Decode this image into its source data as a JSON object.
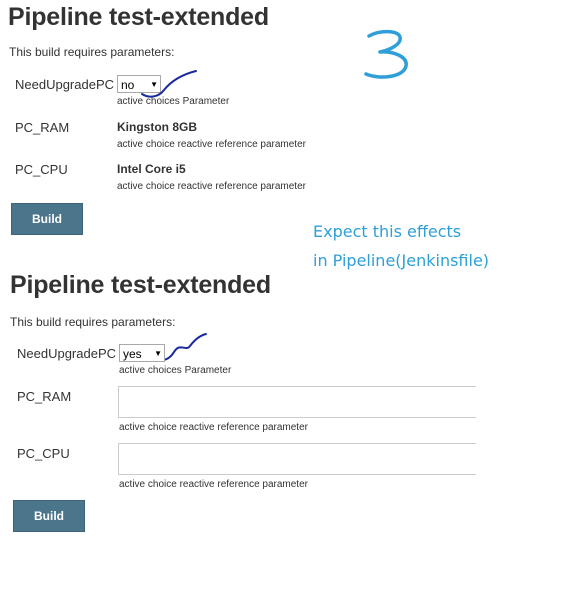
{
  "annotation_three": "3",
  "note": {
    "line1": "Expect this effects",
    "line2": "in Pipeline(Jenkinsfile)"
  },
  "colors": {
    "button": "#4b758b",
    "note_text": "#2e9fd8",
    "scribble": "#1a2a9c"
  },
  "panel_top": {
    "title": "Pipeline test-extended",
    "subtitle": "This build requires parameters:",
    "params": [
      {
        "name": "NeedUpgradePC",
        "value": "no",
        "description": "active choices Parameter"
      },
      {
        "name": "PC_RAM",
        "value": "Kingston 8GB",
        "description": "active choice reactive reference parameter"
      },
      {
        "name": "PC_CPU",
        "value": "Intel Core i5",
        "description": "active choice reactive reference parameter"
      }
    ],
    "build_label": "Build"
  },
  "panel_bottom": {
    "title": "Pipeline test-extended",
    "subtitle": "This build requires parameters:",
    "params": [
      {
        "name": "NeedUpgradePC",
        "value": "yes",
        "description": "active choices Parameter"
      },
      {
        "name": "PC_RAM",
        "value": "",
        "description": "active choice reactive reference parameter"
      },
      {
        "name": "PC_CPU",
        "value": "",
        "description": "active choice reactive reference parameter"
      }
    ],
    "build_label": "Build"
  }
}
